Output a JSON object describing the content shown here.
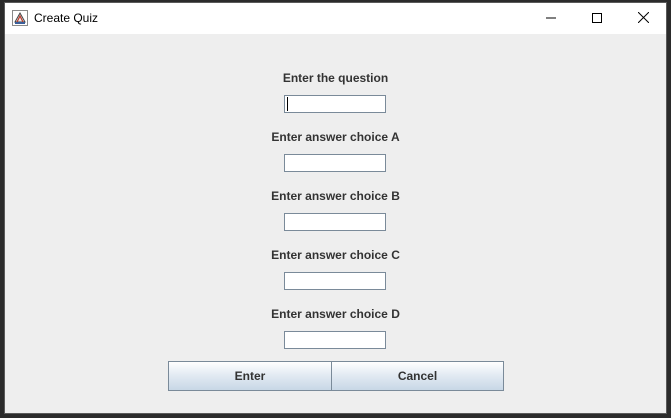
{
  "window": {
    "title": "Create Quiz",
    "app_icon": "java-cup-icon",
    "controls": [
      "minimize-icon",
      "maximize-icon",
      "close-icon"
    ]
  },
  "form": {
    "fields": [
      {
        "label": "Enter the question",
        "value": ""
      },
      {
        "label": "Enter answer choice A",
        "value": ""
      },
      {
        "label": "Enter answer choice B",
        "value": ""
      },
      {
        "label": "Enter answer choice C",
        "value": ""
      },
      {
        "label": "Enter answer choice D",
        "value": ""
      }
    ]
  },
  "buttons": {
    "enter_label": "Enter",
    "cancel_label": "Cancel"
  },
  "colors": {
    "window_bg": "#eeeeee",
    "titlebar_bg": "#ffffff",
    "label_text": "#333333",
    "input_border": "#7a8a99"
  }
}
